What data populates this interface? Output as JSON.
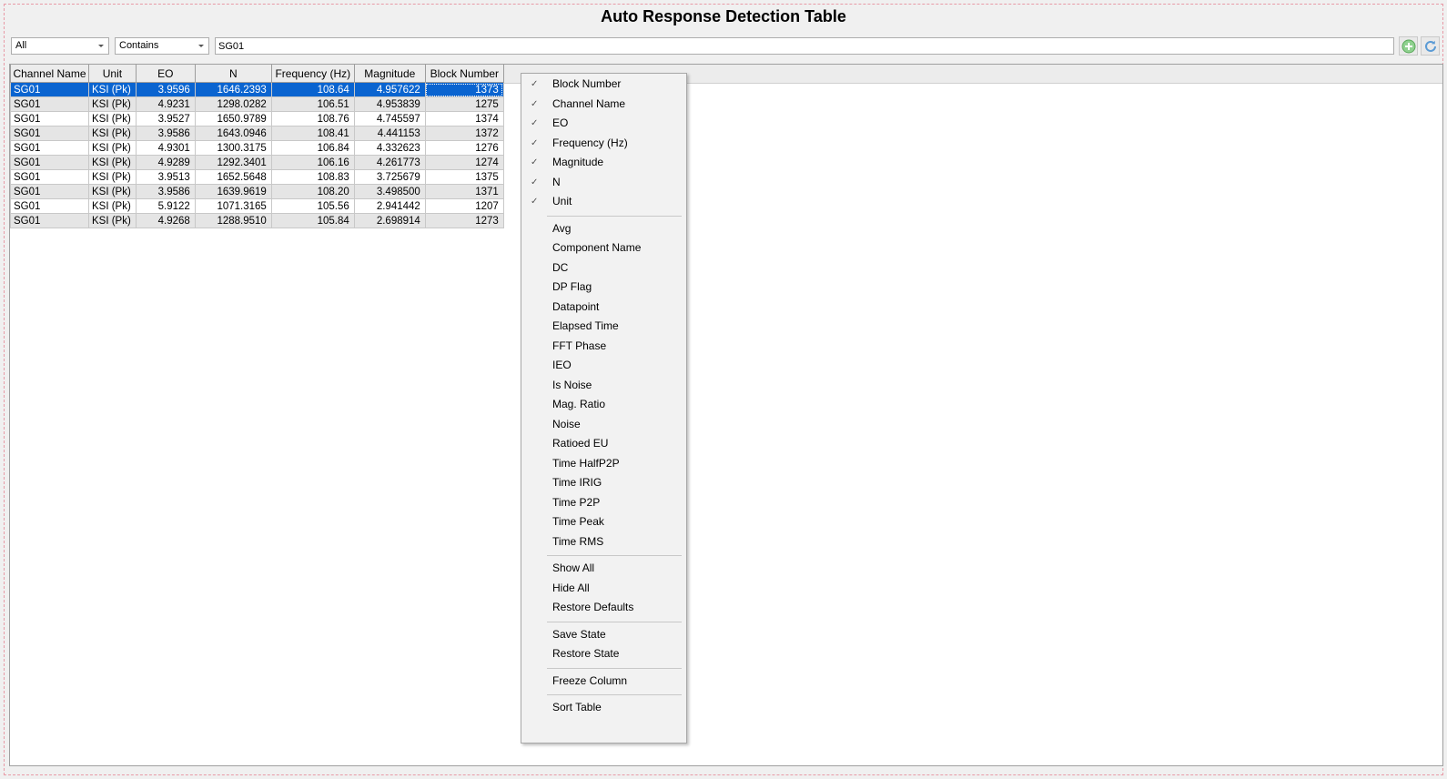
{
  "window": {
    "title": "Auto Response Detection Table"
  },
  "filters": {
    "column_filter": "All",
    "match_mode": "Contains",
    "search_value": "SG01"
  },
  "toolbar": {
    "add_icon": "plus-circle-icon",
    "refresh_icon": "refresh-icon"
  },
  "table": {
    "columns": [
      "Channel Name",
      "Unit",
      "EO",
      "N",
      "Frequency (Hz)",
      "Magnitude",
      "Block Number"
    ],
    "rows": [
      [
        "SG01",
        "KSI (Pk)",
        "3.9596",
        "1646.2393",
        "108.64",
        "4.957622",
        "1373"
      ],
      [
        "SG01",
        "KSI (Pk)",
        "4.9231",
        "1298.0282",
        "106.51",
        "4.953839",
        "1275"
      ],
      [
        "SG01",
        "KSI (Pk)",
        "3.9527",
        "1650.9789",
        "108.76",
        "4.745597",
        "1374"
      ],
      [
        "SG01",
        "KSI (Pk)",
        "3.9586",
        "1643.0946",
        "108.41",
        "4.441153",
        "1372"
      ],
      [
        "SG01",
        "KSI (Pk)",
        "4.9301",
        "1300.3175",
        "106.84",
        "4.332623",
        "1276"
      ],
      [
        "SG01",
        "KSI (Pk)",
        "4.9289",
        "1292.3401",
        "106.16",
        "4.261773",
        "1274"
      ],
      [
        "SG01",
        "KSI (Pk)",
        "3.9513",
        "1652.5648",
        "108.83",
        "3.725679",
        "1375"
      ],
      [
        "SG01",
        "KSI (Pk)",
        "3.9586",
        "1639.9619",
        "108.20",
        "3.498500",
        "1371"
      ],
      [
        "SG01",
        "KSI (Pk)",
        "5.9122",
        "1071.3165",
        "105.56",
        "2.941442",
        "1207"
      ],
      [
        "SG01",
        "KSI (Pk)",
        "4.9268",
        "1288.9510",
        "105.84",
        "2.698914",
        "1273"
      ]
    ],
    "selected_row": 0
  },
  "context_menu": {
    "groups": [
      [
        {
          "label": "Block Number",
          "checked": true
        },
        {
          "label": "Channel Name",
          "checked": true
        },
        {
          "label": "EO",
          "checked": true
        },
        {
          "label": "Frequency (Hz)",
          "checked": true
        },
        {
          "label": "Magnitude",
          "checked": true
        },
        {
          "label": "N",
          "checked": true
        },
        {
          "label": "Unit",
          "checked": true
        }
      ],
      [
        {
          "label": "Avg"
        },
        {
          "label": "Component Name"
        },
        {
          "label": "DC"
        },
        {
          "label": "DP Flag"
        },
        {
          "label": "Datapoint"
        },
        {
          "label": "Elapsed Time"
        },
        {
          "label": "FFT Phase"
        },
        {
          "label": "IEO"
        },
        {
          "label": "Is Noise"
        },
        {
          "label": "Mag. Ratio"
        },
        {
          "label": "Noise"
        },
        {
          "label": "Ratioed EU"
        },
        {
          "label": "Time HalfP2P"
        },
        {
          "label": "Time IRIG"
        },
        {
          "label": "Time P2P"
        },
        {
          "label": "Time Peak"
        },
        {
          "label": "Time RMS"
        }
      ],
      [
        {
          "label": "Show All"
        },
        {
          "label": "Hide All"
        },
        {
          "label": "Restore Defaults"
        }
      ],
      [
        {
          "label": "Save State"
        },
        {
          "label": "Restore State"
        }
      ],
      [
        {
          "label": "Freeze Column"
        }
      ],
      [
        {
          "label": "Sort Table"
        }
      ]
    ]
  },
  "colors": {
    "selection": "#0a64d0",
    "alt_row": "#e5e5e5",
    "frame_dash": "#e89aa6",
    "add_icon": "#7bc67b",
    "refresh_icon": "#5b9bd5"
  }
}
